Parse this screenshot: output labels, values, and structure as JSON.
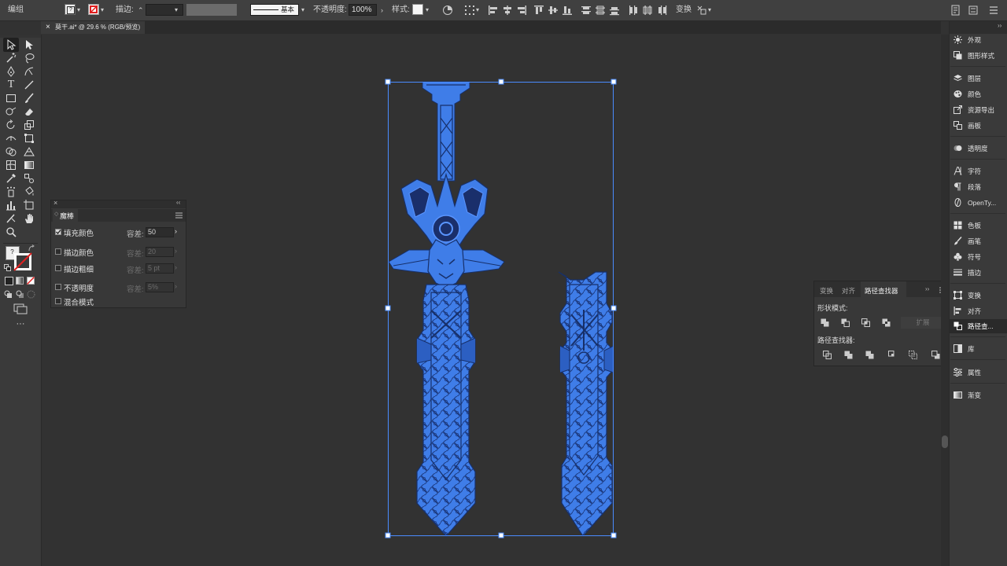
{
  "control_bar": {
    "selection_label": "编组",
    "stroke_label": "描边:",
    "brush_label": "基本",
    "opacity_label": "不透明度:",
    "opacity_value": "100%",
    "style_label": "样式:",
    "transform_label": "变换"
  },
  "document_tab": {
    "close": "×",
    "title": "莫干.ai* @ 29.6 % (RGB/预览)"
  },
  "toolbox": {
    "more": "···"
  },
  "magic_wand_panel": {
    "title": "魔棒",
    "rows": [
      {
        "label": "填充颜色",
        "checked": true,
        "tolerance_label": "容差:",
        "tolerance_value": "50",
        "enabled": true
      },
      {
        "label": "描边颜色",
        "checked": false,
        "tolerance_label": "容差:",
        "tolerance_value": "20",
        "enabled": false
      },
      {
        "label": "描边粗细",
        "checked": false,
        "tolerance_label": "容差:",
        "tolerance_value": "5 pt",
        "enabled": false
      },
      {
        "label": "不透明度",
        "checked": false,
        "tolerance_label": "容差:",
        "tolerance_value": "5%",
        "enabled": false
      },
      {
        "label": "混合模式",
        "checked": false
      }
    ]
  },
  "pathfinder_panel": {
    "tabs": [
      "变换",
      "对齐",
      "路径查找器"
    ],
    "active_tab": "路径查找器",
    "shape_modes_label": "形状模式:",
    "expand_label": "扩展",
    "pathfinders_label": "路径查找器:"
  },
  "dock": {
    "items": [
      {
        "label": "外观",
        "icon": "sun-icon"
      },
      {
        "label": "图形样式",
        "icon": "graphic-styles-icon"
      },
      {
        "label": "图层",
        "icon": "layers-icon"
      },
      {
        "label": "颜色",
        "icon": "palette-icon"
      },
      {
        "label": "资源导出",
        "icon": "export-icon"
      },
      {
        "label": "画板",
        "icon": "artboard-icon"
      },
      {
        "label": "透明度",
        "icon": "transparency-icon"
      },
      {
        "label": "字符",
        "icon": "character-icon"
      },
      {
        "label": "段落",
        "icon": "paragraph-icon"
      },
      {
        "label": "OpenTy...",
        "icon": "opentype-icon"
      },
      {
        "label": "色板",
        "icon": "swatches-icon"
      },
      {
        "label": "画笔",
        "icon": "brush-icon"
      },
      {
        "label": "符号",
        "icon": "club-icon"
      },
      {
        "label": "描边",
        "icon": "stroke-icon"
      },
      {
        "label": "变换",
        "icon": "transform-icon"
      },
      {
        "label": "对齐",
        "icon": "align-icon"
      },
      {
        "label": "路径查...",
        "icon": "pathfinder-icon"
      },
      {
        "label": "库",
        "icon": "library-icon"
      },
      {
        "label": "属性",
        "icon": "properties-icon"
      },
      {
        "label": "渐变",
        "icon": "gradient-icon"
      }
    ]
  },
  "colors": {
    "selection": "#4a8cff",
    "artwork_fill": "#3f7de8",
    "artwork_line": "#17306a",
    "canvas": "#323232"
  }
}
